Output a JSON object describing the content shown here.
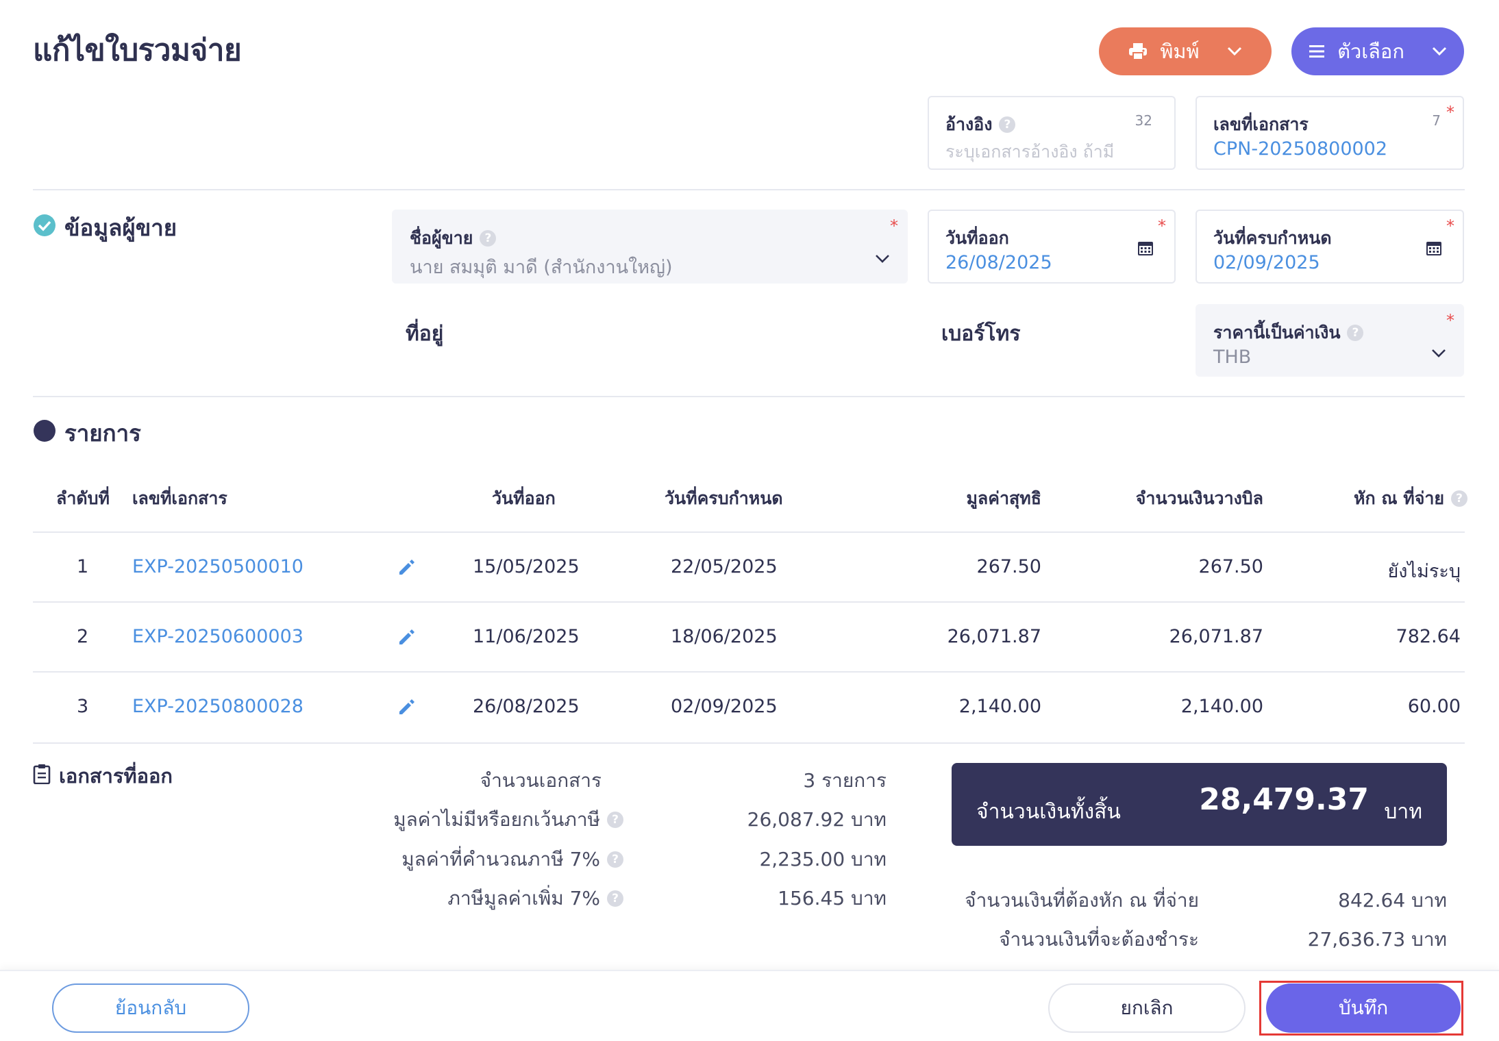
{
  "header": {
    "title": "แก้ไขใบรวมจ่าย",
    "print_label": "พิมพ์",
    "options_label": "ตัวเลือก"
  },
  "reference": {
    "label": "อ้างอิง",
    "placeholder": "ระบุเอกสารอ้างอิง ถ้ามี",
    "count": "32"
  },
  "doc_number": {
    "label": "เลขที่เอกสาร",
    "value": "CPN-20250800002",
    "count": "7",
    "required": "*"
  },
  "seller": {
    "section_title": "ข้อมูลผู้ขาย",
    "name_label": "ชื่อผู้ขาย",
    "name_value": "นาย สมมุติ มาดี (สำนักงานใหญ่)",
    "required": "*",
    "address_label": "ที่อยู่",
    "phone_label": "เบอร์โทร"
  },
  "issue_date": {
    "label": "วันที่ออก",
    "value": "26/08/2025",
    "required": "*"
  },
  "due_date": {
    "label": "วันที่ครบกำหนด",
    "value": "02/09/2025",
    "required": "*"
  },
  "currency": {
    "label": "ราคานี้เป็นค่าเงิน",
    "value": "THB",
    "required": "*"
  },
  "items": {
    "section_title": "รายการ",
    "columns": {
      "seq": "ลำดับที่",
      "doc_no": "เลขที่เอกสาร",
      "issue_date": "วันที่ออก",
      "due_date": "วันที่ครบกำหนด",
      "net_value": "มูลค่าสุทธิ",
      "billing_amount": "จำนวนเงินวางบิล",
      "withholding": "หัก ณ ที่จ่าย"
    },
    "rows": [
      {
        "seq": "1",
        "doc_no": "EXP-20250500010",
        "issue_date": "15/05/2025",
        "due_date": "22/05/2025",
        "net_value": "267.50",
        "billing_amount": "267.50",
        "withholding": "ยังไม่ระบุ"
      },
      {
        "seq": "2",
        "doc_no": "EXP-20250600003",
        "issue_date": "11/06/2025",
        "due_date": "18/06/2025",
        "net_value": "26,071.87",
        "billing_amount": "26,071.87",
        "withholding": "782.64"
      },
      {
        "seq": "3",
        "doc_no": "EXP-20250800028",
        "issue_date": "26/08/2025",
        "due_date": "02/09/2025",
        "net_value": "2,140.00",
        "billing_amount": "2,140.00",
        "withholding": "60.00"
      }
    ]
  },
  "summary": {
    "section_title": "เอกสารที่ออก",
    "doc_count_label": "จำนวนเอกสาร",
    "doc_count_value": "3 รายการ",
    "non_taxable_label": "มูลค่าไม่มีหรือยกเว้นภาษี",
    "non_taxable_value": "26,087.92 บาท",
    "taxable_label": "มูลค่าที่คำนวณภาษี 7%",
    "taxable_value": "2,235.00 บาท",
    "vat_label": "ภาษีมูลค่าเพิ่ม 7%",
    "vat_value": "156.45 บาท",
    "total_label": "จำนวนเงินทั้งสิ้น",
    "total_amount": "28,479.37",
    "total_unit": "บาท",
    "withholding_label": "จำนวนเงินที่ต้องหัก ณ ที่จ่าย",
    "withholding_value": "842.64 บาท",
    "payable_label": "จำนวนเงินที่จะต้องชำระ",
    "payable_value": "27,636.73 บาท"
  },
  "footer": {
    "back_label": "ย้อนกลับ",
    "cancel_label": "ยกเลิก",
    "save_label": "บันทึก"
  },
  "colors": {
    "print_button": "#ea7b5c",
    "options_button": "#6c6ae6",
    "link": "#4a8fe0",
    "total_box": "#34345a",
    "save_button": "#6a65e8",
    "highlight_frame": "#e53935"
  }
}
